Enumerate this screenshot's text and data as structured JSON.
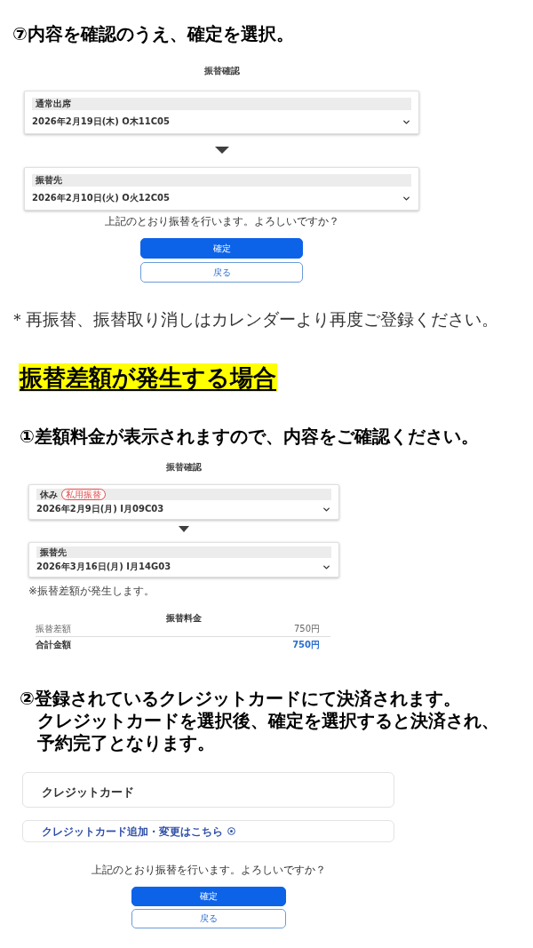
{
  "step_7": {
    "instruction": "⑦内容を確認のうえ、確定を選択。",
    "screen": {
      "title": "振替確認",
      "cards": [
        {
          "label": "通常出席",
          "value": "2026年2月19日(木) O木11C05"
        },
        {
          "label": "振替先",
          "value": "2026年2月10日(火) O火12C05"
        }
      ],
      "question": "上記のとおり振替を行います。よろしいですか？",
      "buttons": [
        {
          "label": "確定",
          "kind": "primary"
        },
        {
          "label": "戻る",
          "kind": "secondary"
        }
      ]
    }
  },
  "note": "＊再振替、振替取り消しはカレンダーより再度ご登録ください。",
  "difference_case": {
    "heading": "振替差額が発生する場合",
    "step_1": {
      "instruction": "①差額料金が表示されますので、内容をご確認ください。",
      "screen": {
        "title": "振替確認",
        "cards": [
          {
            "label": "休み",
            "badge": "私用振替",
            "value": "2026年2月9日(月) I月09C03"
          },
          {
            "label": "振替先",
            "value": "2026年3月16日(月) I月14G03"
          }
        ],
        "notice": "※振替差額が発生します。",
        "fee": {
          "title": "振替料金",
          "rows": [
            {
              "label": "振替差額",
              "amount": "750円",
              "kind": "item"
            },
            {
              "label": "合計金額",
              "amount": "750円",
              "kind": "total"
            }
          ]
        }
      }
    },
    "step_2": {
      "instruction_lines": [
        "②登録されているクレジットカードにて決済されます。",
        "クレジットカードを選択後、確定を選択すると決済され、",
        "予約完了となります。"
      ],
      "screen": {
        "card_panel": {
          "title": "クレジットカード"
        },
        "link": "クレジットカード追加・変更はこちら",
        "question": "上記のとおり振替を行います。よろしいですか？",
        "buttons": [
          {
            "label": "確定",
            "kind": "primary"
          },
          {
            "label": "戻る",
            "kind": "secondary"
          }
        ]
      }
    }
  }
}
